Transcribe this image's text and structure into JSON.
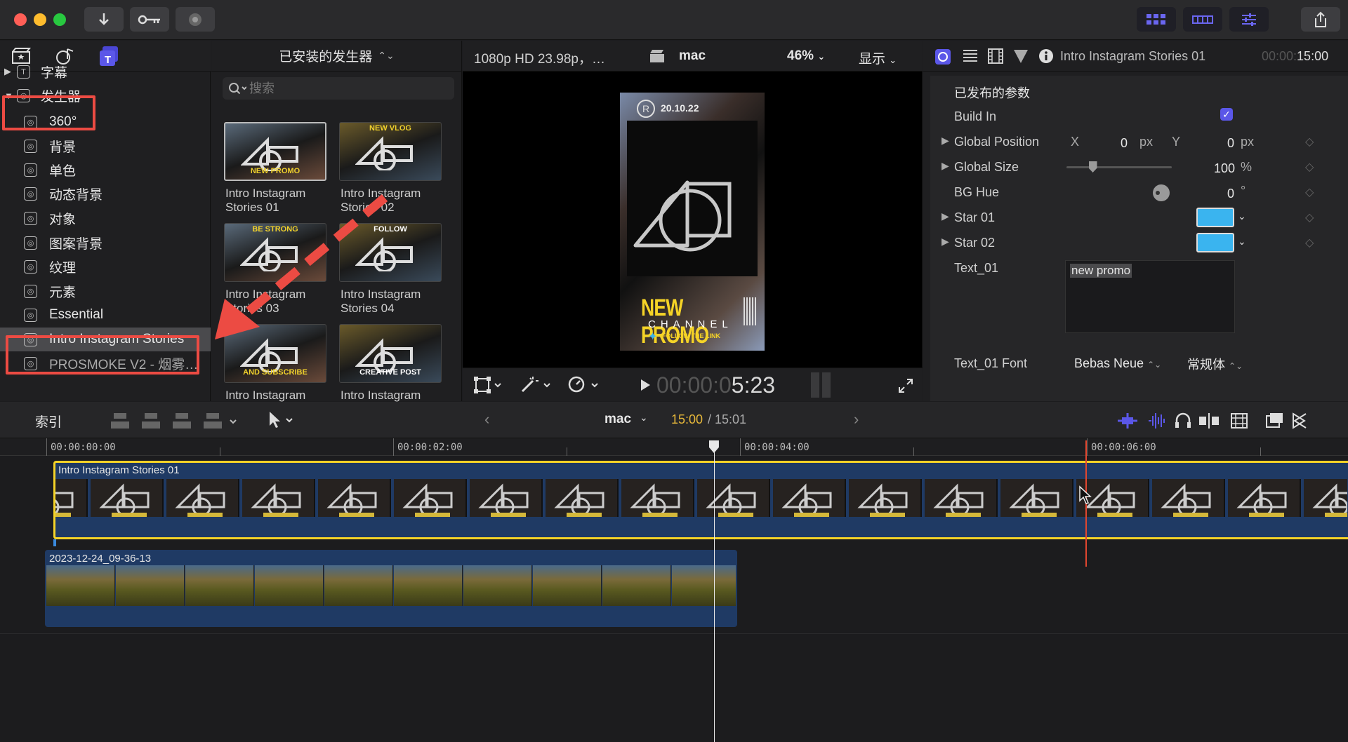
{
  "toolbar": {
    "import_icon": "download-arrow-icon",
    "keywords_icon": "key-icon",
    "bg_tasks_icon": "circle-icon",
    "share_icon": "share-icon"
  },
  "browser": {
    "library_title": "已安装的发生器",
    "search_placeholder": "搜索",
    "sidebar": [
      {
        "label": "字幕",
        "expanded": false
      },
      {
        "label": "发生器",
        "expanded": true
      },
      {
        "label": "360°"
      },
      {
        "label": "背景"
      },
      {
        "label": "单色"
      },
      {
        "label": "动态背景"
      },
      {
        "label": "对象"
      },
      {
        "label": "图案背景"
      },
      {
        "label": "纹理"
      },
      {
        "label": "元素"
      },
      {
        "label": "Essential"
      },
      {
        "label": "Intro Instagram Stories"
      },
      {
        "label": "PROSMOKE V2 - 烟雾…"
      }
    ],
    "thumbnails": [
      {
        "caption": "Intro Instagram Stories 01",
        "tag": "NEW PROMO",
        "color": "#f0d12c"
      },
      {
        "caption": "Intro Instagram Stories 02",
        "tag": "NEW VLOG",
        "color": "#f0d12c"
      },
      {
        "caption": "Intro Instagram Stories 03",
        "tag": "BE STRONG",
        "color": "#f0d12c"
      },
      {
        "caption": "Intro Instagram Stories 04",
        "tag": "FOLLOW",
        "color": "#ffffff"
      },
      {
        "caption": "Intro Instagram",
        "tag": "AND SUBSCRIBE",
        "color": "#f0d12c"
      },
      {
        "caption": "Intro Instagram",
        "tag": "CREATIVE POST",
        "color": "#ffffff"
      }
    ]
  },
  "viewer": {
    "format": "1080p HD 23.98p，…",
    "library": "mac",
    "zoom": "46%",
    "display": "显示",
    "timecode_dim": "00:00:0",
    "timecode_bright": "5:23",
    "preview": {
      "date": "20.10.22",
      "badge": "R",
      "headline": "NEW PROMO",
      "channel": "CHANNEL",
      "follow": "FOLLOW THE LINK"
    }
  },
  "inspector": {
    "clip_title": "Intro Instagram Stories 01",
    "duration_dim": "00:00:",
    "duration_bright": "15:00",
    "section": "已发布的参数",
    "params": {
      "build_in": "Build In",
      "global_position": "Global Position",
      "pos_x_label": "X",
      "pos_x": "0",
      "pos_y_label": "Y",
      "pos_y": "0",
      "px": "px",
      "global_size": "Global Size",
      "size_value": "100",
      "size_unit": "%",
      "size_slider": 0.25,
      "bg_hue": "BG Hue",
      "hue_value": "0",
      "hue_unit": "°",
      "star01": "Star 01",
      "star02": "Star 02",
      "star_color": "#3ab4ef",
      "text01": "Text_01",
      "text01_value": "new promo",
      "text01_font": "Text_01 Font",
      "font_value": "Bebas Neue",
      "style_value": "常规体"
    }
  },
  "timeline": {
    "index_label": "索引",
    "project": "mac",
    "position": "15:00",
    "duration": "/ 15:01",
    "ruler": [
      "00:00:00:00",
      "00:00:02:00",
      "00:00:04:00",
      "00:00:06:00"
    ],
    "clip1": "Intro Instagram Stories 01",
    "clip2": "2023-12-24_09-36-13",
    "playhead_seconds": 3.85,
    "skimmer_seconds": 5.99
  },
  "colors": {
    "accent": "#5b57e8",
    "selection": "#f5d327",
    "annotation": "#ec4b43",
    "playhead": "#e8e8e8",
    "skimmer": "#e0462f"
  }
}
